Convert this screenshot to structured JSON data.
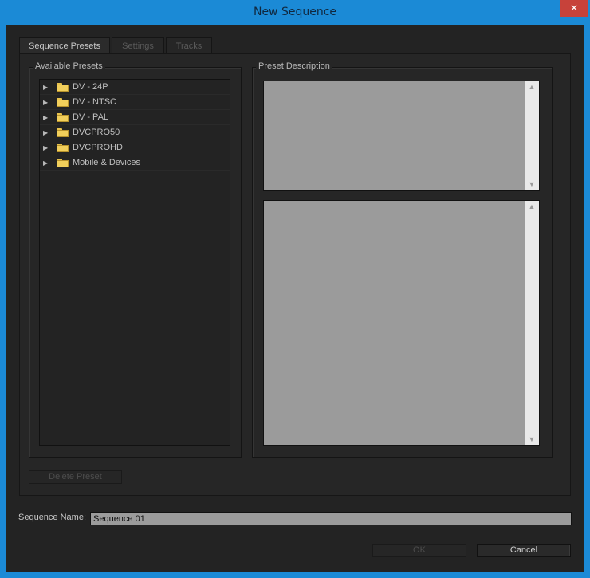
{
  "window": {
    "title": "New Sequence",
    "close_glyph": "✕"
  },
  "tabs": [
    {
      "label": "Sequence Presets",
      "active": true
    },
    {
      "label": "Settings",
      "active": false
    },
    {
      "label": "Tracks",
      "active": false
    }
  ],
  "available_presets": {
    "label": "Available Presets",
    "items": [
      {
        "label": "DV - 24P",
        "icon": "folder-icon"
      },
      {
        "label": "DV - NTSC",
        "icon": "folder-icon"
      },
      {
        "label": "DV - PAL",
        "icon": "folder-icon"
      },
      {
        "label": "DVCPRO50",
        "icon": "folder-icon"
      },
      {
        "label": "DVCPROHD",
        "icon": "folder-icon"
      },
      {
        "label": "Mobile & Devices",
        "icon": "folder-icon"
      }
    ]
  },
  "preset_description": {
    "label": "Preset Description",
    "top_text": "",
    "bottom_text": ""
  },
  "buttons": {
    "delete_preset": "Delete Preset",
    "ok": "OK",
    "cancel": "Cancel"
  },
  "sequence_name": {
    "label": "Sequence Name:",
    "value": "Sequence 01"
  },
  "colors": {
    "title_bar": "#1b8ad6",
    "close_button": "#c7423a",
    "panel_bg": "#232323",
    "description_bg": "#9b9b9b",
    "folder": "#f2cf5b"
  }
}
